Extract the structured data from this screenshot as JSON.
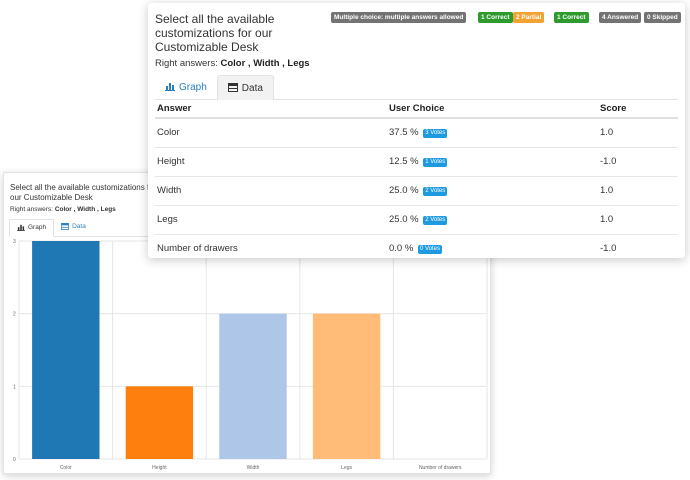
{
  "back": {
    "question": "Select all the available customizations for our Customizable Desk",
    "right_answers_label": "Right answers:",
    "right_answers": "Color , Width , Legs",
    "tabs": [
      {
        "label": "Graph"
      },
      {
        "label": "Data"
      }
    ]
  },
  "front": {
    "question": "Select all the available customizations for our Customizable Desk",
    "right_answers_label": "Right answers:",
    "right_answers": "Color , Width , Legs",
    "badges": {
      "type": "Multiple choice: multiple answers allowed",
      "correct": "1 Correct",
      "partial": "2 Partial",
      "correct2": "1 Correct",
      "answered": "4 Answered",
      "skipped": "0 Skipped"
    },
    "tabs": [
      {
        "label": "Graph"
      },
      {
        "label": "Data"
      }
    ],
    "table": {
      "headers": [
        "Answer",
        "User Choice",
        "Score"
      ],
      "rows": [
        {
          "answer": "Color",
          "choice": "37.5 %",
          "votes": "3 Votes",
          "score": "1.0"
        },
        {
          "answer": "Height",
          "choice": "12.5 %",
          "votes": "1 Votes",
          "score": "-1.0"
        },
        {
          "answer": "Width",
          "choice": "25.0 %",
          "votes": "2 Votes",
          "score": "1.0"
        },
        {
          "answer": "Legs",
          "choice": "25.0 %",
          "votes": "2 Votes",
          "score": "1.0"
        },
        {
          "answer": "Number of drawers",
          "choice": "0.0 %",
          "votes": "0 Votes",
          "score": "-1.0"
        }
      ]
    }
  },
  "colors": {
    "badge_gray": "#737373",
    "badge_green": "#2f9b2f",
    "badge_orange": "#f0a233",
    "votes_blue": "#1e9be0",
    "tab_blue": "#2a7fc1"
  },
  "chart_data": {
    "type": "bar",
    "categories": [
      "Color",
      "Height",
      "Width",
      "Legs",
      "Number of drawers"
    ],
    "values": [
      3,
      1,
      2,
      2,
      0
    ],
    "colors": [
      "#1f77b4",
      "#ff7f0e",
      "#aec7e8",
      "#ffbb78",
      "#98df8a"
    ],
    "ylim": [
      0,
      3
    ],
    "yticks": [
      "0",
      "1",
      "2",
      "3"
    ],
    "grid": true
  }
}
